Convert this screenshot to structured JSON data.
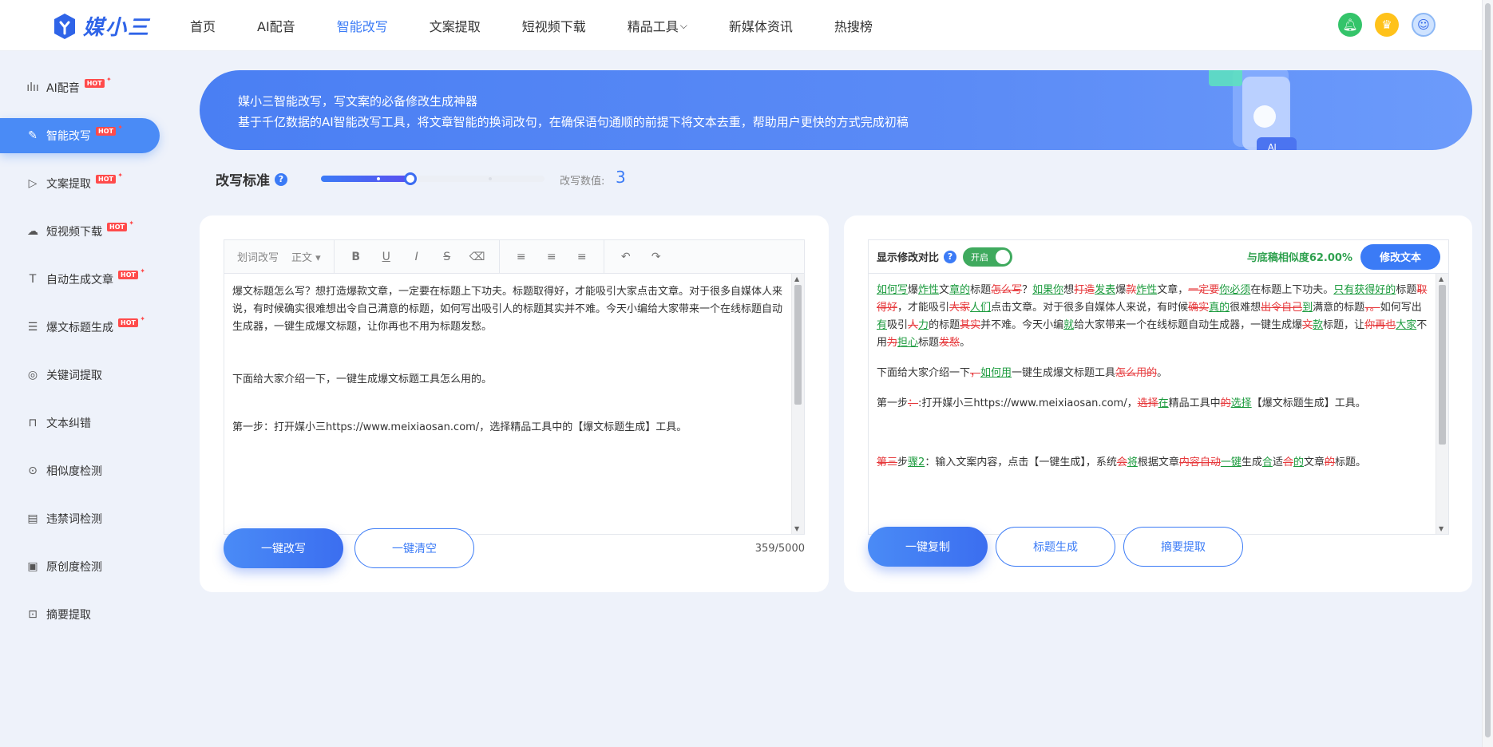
{
  "brand": {
    "name": "媒小三"
  },
  "nav": [
    {
      "label": "首页"
    },
    {
      "label": "AI配音"
    },
    {
      "label": "智能改写"
    },
    {
      "label": "文案提取"
    },
    {
      "label": "短视频下载"
    },
    {
      "label": "精品工具"
    },
    {
      "label": "新媒体资讯"
    },
    {
      "label": "热搜榜"
    }
  ],
  "sidebar": [
    {
      "label": "AI配音",
      "hot": "HOT",
      "icon": "sound-wave-icon"
    },
    {
      "label": "智能改写",
      "hot": "HOT",
      "icon": "edit-icon"
    },
    {
      "label": "文案提取",
      "hot": "HOT",
      "icon": "video-play-icon"
    },
    {
      "label": "短视频下载",
      "hot": "HOT",
      "icon": "cloud-download-icon"
    },
    {
      "label": "自动生成文章",
      "hot": "HOT",
      "icon": "text-icon"
    },
    {
      "label": "爆文标题生成",
      "hot": "HOT",
      "icon": "title-icon"
    },
    {
      "label": "关键词提取",
      "icon": "target-icon"
    },
    {
      "label": "文本纠错",
      "icon": "lock-icon"
    },
    {
      "label": "相似度检测",
      "icon": "search-doc-icon"
    },
    {
      "label": "违禁词检测",
      "icon": "forbidden-doc-icon"
    },
    {
      "label": "原创度检测",
      "icon": "original-doc-icon"
    },
    {
      "label": "摘要提取",
      "icon": "summary-icon"
    }
  ],
  "banner": {
    "line1": "媒小三智能改写，写文案的必备修改生成神器",
    "line2": "基于千亿数据的AI智能改写工具，将文章智能的换词改句，在确保语句通顺的前提下将文本去重，帮助用户更快的方式完成初稿"
  },
  "rewrite": {
    "label": "改写标准",
    "help": "?",
    "value_label": "改写数值:",
    "value": "3",
    "level_fraction": 0.4
  },
  "toolbar": {
    "word_rewrite": "划词改写",
    "paragraph": "正文"
  },
  "source": {
    "p1": "爆文标题怎么写？想打造爆款文章，一定要在标题上下功夫。标题取得好，才能吸引大家点击文章。对于很多自媒体人来说，有时候确实很难想出令自己满意的标题，如何写出吸引人的标题其实并不难。今天小编给大家带来一个在线标题自动生成器，一键生成爆文标题，让你再也不用为标题发愁。",
    "p2": "下面给大家介绍一下，一键生成爆文标题工具怎么用的。",
    "p3": "第一步：打开媒小三https://www.meixiaosan.com/，选择精品工具中的【爆文标题生成】工具。"
  },
  "left_buttons": {
    "rewrite": "一键改写",
    "clear": "一键清空"
  },
  "char_count": "359/5000",
  "compare": {
    "title": "显示修改对比",
    "help": "?",
    "toggle": "开启",
    "similarity": "与底稿相似度62.00%",
    "modify_btn": "修改文本"
  },
  "right_buttons": {
    "copy": "一键复制",
    "title_gen": "标题生成",
    "summary": "摘要提取"
  },
  "colors": {
    "accent": "#3b7bf6",
    "insert": "#1a9a3c",
    "delete": "#e6383b"
  }
}
